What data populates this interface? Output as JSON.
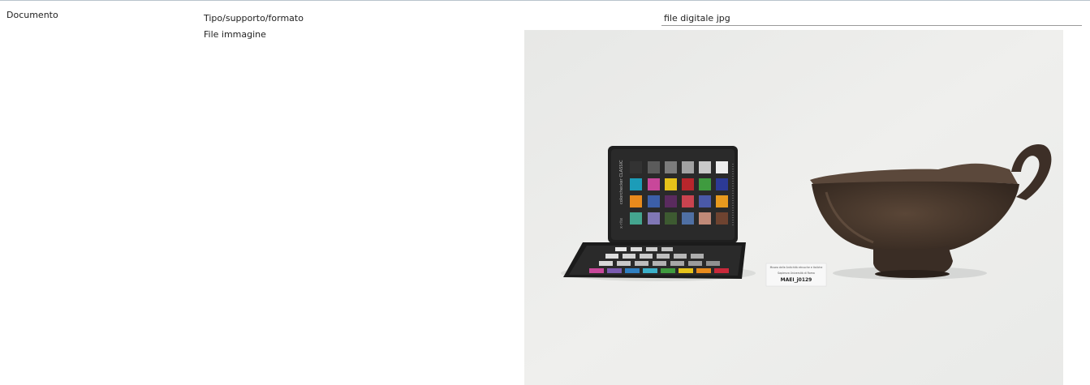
{
  "section": {
    "label": "Documento"
  },
  "fields": {
    "type_label": "Tipo/supporto/formato",
    "type_value": "file digitale jpg",
    "image_label": "File immagine"
  },
  "image": {
    "tag_line1": "Museo delle Antichità etrusche e italiche",
    "tag_line2": "Sapienza Università di Roma",
    "inventory_code": "MAEI_j0129",
    "checker_brand": "colorchecker CLASSIC",
    "checker_maker": "x-rite"
  },
  "colors": {
    "background_border": "#b8c4cc",
    "photo_background": "#eeefed",
    "vessel": "#4a3a31"
  }
}
